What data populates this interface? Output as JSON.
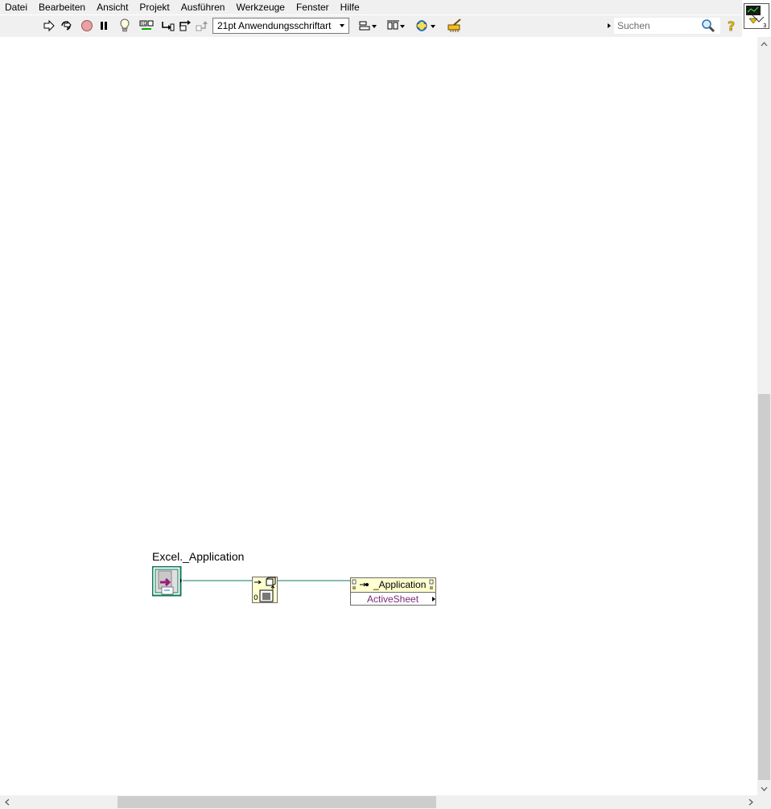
{
  "menu": {
    "items": [
      "Datei",
      "Bearbeiten",
      "Ansicht",
      "Projekt",
      "Ausführen",
      "Werkzeuge",
      "Fenster",
      "Hilfe"
    ]
  },
  "toolbar": {
    "font_select_value": "21pt Anwendungsschriftart",
    "search_placeholder": "Suchen"
  },
  "diagram": {
    "refnum_label": "Excel._Application",
    "property_node_class": "_Application",
    "property_node_property": "ActiveSheet"
  },
  "colors": {
    "refnum_wire": "#0f7a5c",
    "node_header": "#ffffd0",
    "property_text": "#7a2a7a"
  }
}
